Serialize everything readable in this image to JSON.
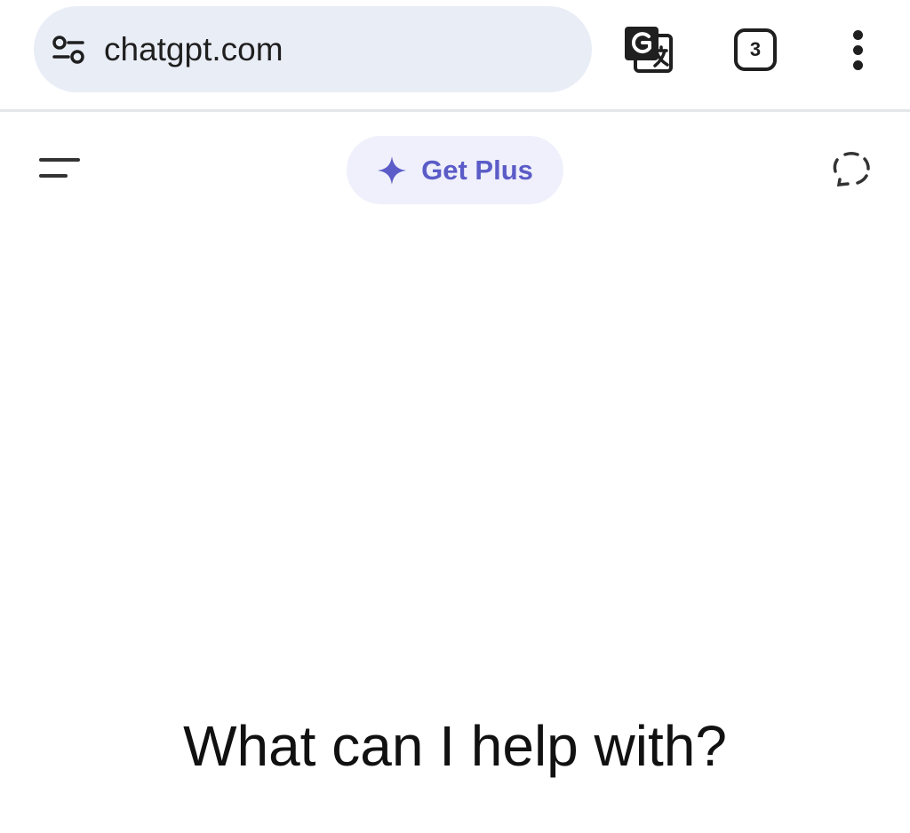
{
  "browser": {
    "url": "chatgpt.com",
    "tab_count": "3",
    "icons": {
      "site_settings": "site-settings-icon",
      "translate": "translate-icon",
      "menu": "more-vertical-icon"
    }
  },
  "app_header": {
    "upgrade_label": "Get Plus",
    "icons": {
      "menu": "sidebar-menu-icon",
      "upgrade": "sparkle-icon",
      "temporary_chat": "temporary-chat-icon"
    }
  },
  "main": {
    "prompt_heading": "What can I help with?"
  },
  "colors": {
    "omnibox_bg": "#e9edf6",
    "accent": "#5b5cc7",
    "accent_bg": "#eff0fb",
    "text": "#1f1f1f"
  }
}
